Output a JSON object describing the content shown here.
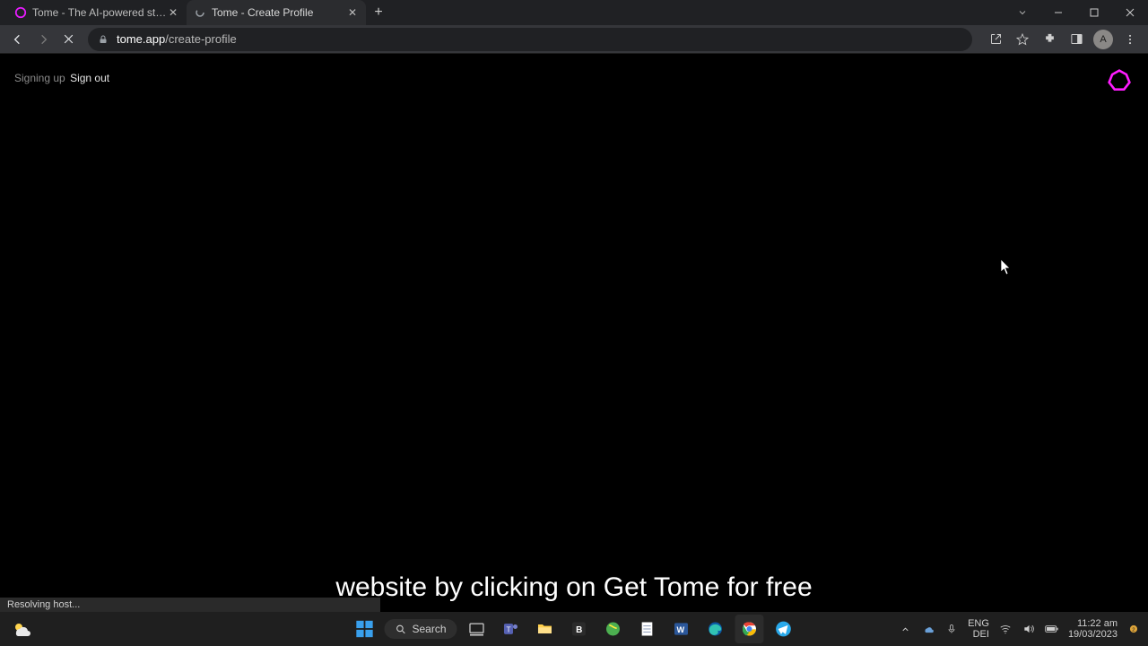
{
  "window": {
    "tabs": [
      {
        "title": "Tome - The AI-powered storytell",
        "active": false
      },
      {
        "title": "Tome - Create Profile",
        "active": true
      }
    ]
  },
  "toolbar": {
    "url_host": "tome.app",
    "url_path": "/create-profile"
  },
  "browser_ui": {
    "avatar_letter": "A"
  },
  "page": {
    "signing_up_text": "Signing up",
    "sign_out_label": "Sign out"
  },
  "caption": {
    "text": "website by clicking on Get Tome for free"
  },
  "status": {
    "text": "Resolving host..."
  },
  "taskbar": {
    "search_label": "Search",
    "lang_top": "ENG",
    "lang_bottom": "DEI",
    "time": "11:22 am",
    "date": "19/03/2023"
  }
}
